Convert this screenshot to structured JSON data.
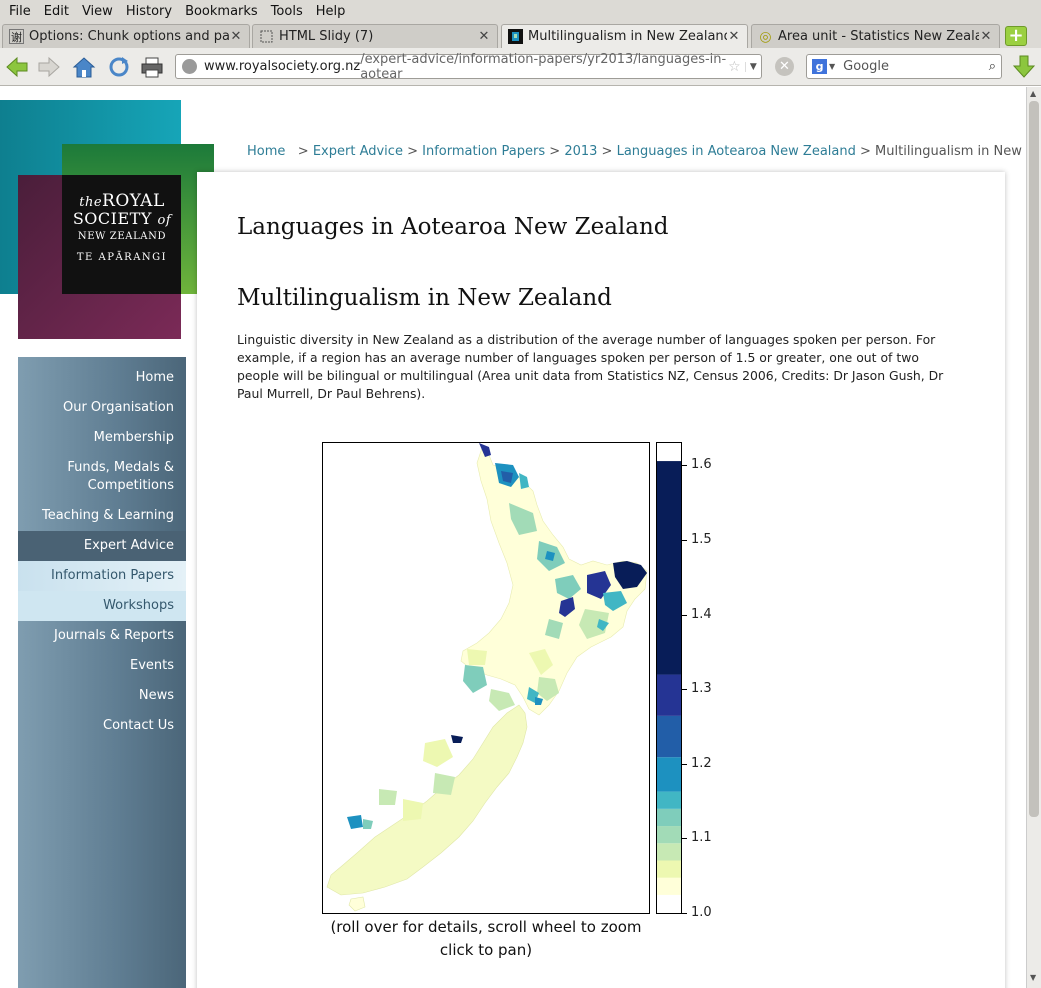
{
  "menubar": [
    "File",
    "Edit",
    "View",
    "History",
    "Bookmarks",
    "Tools",
    "Help"
  ],
  "tabs": [
    {
      "label": "Options: Chunk options and pa...",
      "icon": "谢"
    },
    {
      "label": "HTML Slidy (7)",
      "icon": ""
    },
    {
      "label": "Multilingualism in New Zealand ...",
      "icon": ""
    },
    {
      "label": "Area unit - Statistics New Zealand",
      "icon": "◎"
    }
  ],
  "url": {
    "host": "www.royalsociety.org.nz",
    "path": "/expert-advice/information-papers/yr2013/languages-in-aotear"
  },
  "search": {
    "placeholder": "Google"
  },
  "logo": {
    "line1_the": "the",
    "line1_royal": "ROYAL",
    "line2_society": "SOCIETY",
    "line2_of": "of",
    "line3": "NEW ZEALAND",
    "line4": "TE APĀRANGI"
  },
  "nav": [
    {
      "label": "Home",
      "state": "normal"
    },
    {
      "label": "Our Organisation",
      "state": "normal"
    },
    {
      "label": "Membership",
      "state": "normal"
    },
    {
      "label": "Funds, Medals & Competitions",
      "line1": "Funds, Medals &",
      "line2": "Competitions",
      "state": "normal"
    },
    {
      "label": "Teaching & Learning",
      "state": "normal"
    },
    {
      "label": "Expert Advice",
      "state": "active"
    },
    {
      "label": "Information Papers",
      "state": "sub"
    },
    {
      "label": "Workshops",
      "state": "sub"
    },
    {
      "label": "Journals & Reports",
      "state": "normal"
    },
    {
      "label": "Events",
      "state": "normal"
    },
    {
      "label": "News",
      "state": "normal"
    },
    {
      "label": "Contact Us",
      "state": "normal"
    }
  ],
  "breadcrumb": [
    {
      "label": "Home",
      "link": true
    },
    {
      "label": "Expert Advice",
      "link": true
    },
    {
      "label": "Information Papers",
      "link": true
    },
    {
      "label": "2013",
      "link": true
    },
    {
      "label": "Languages in Aotearoa New Zealand",
      "link": true
    },
    {
      "label": "Multilingualism in New Zealand",
      "link": false
    }
  ],
  "content": {
    "title": "Languages in Aotearoa New Zealand",
    "subtitle": "Multilingualism in New Zealand",
    "description": "Linguistic diversity in New Zealand as a distribution of the average number of languages spoken per person. For example, if a region has an average number of languages spoken per person of 1.5 or greater, one out of two people will be bilingual or multilingual (Area unit data from Statistics NZ, Census 2006, Credits: Dr Jason Gush, Dr Paul Murrell, Dr Paul Behrens).",
    "caption_line1": "(roll over for details, scroll wheel to zoom",
    "caption_line2": "click to pan)"
  },
  "legend": {
    "min": 1.0,
    "max": 1.63,
    "ticks": [
      1.0,
      1.1,
      1.2,
      1.3,
      1.4,
      1.5,
      1.6
    ],
    "tick_labels": [
      "1.0",
      "1.1",
      "1.2",
      "1.3",
      "1.4",
      "1.5",
      "1.6"
    ],
    "bins": [
      {
        "from": 1.0,
        "to": 1.025,
        "color": "#ffffd9"
      },
      {
        "from": 1.025,
        "to": 1.05,
        "color": "#edf8b1"
      },
      {
        "from": 1.05,
        "to": 1.075,
        "color": "#c7e9b4"
      },
      {
        "from": 1.075,
        "to": 1.1,
        "color": "#a2dbb7"
      },
      {
        "from": 1.1,
        "to": 1.125,
        "color": "#7fcdbb"
      },
      {
        "from": 1.125,
        "to": 1.15,
        "color": "#41b6c4"
      },
      {
        "from": 1.15,
        "to": 1.2,
        "color": "#1d91c0"
      },
      {
        "from": 1.2,
        "to": 1.26,
        "color": "#225ea8"
      },
      {
        "from": 1.26,
        "to": 1.32,
        "color": "#253494"
      },
      {
        "from": 1.32,
        "to": 1.63,
        "color": "#081d58"
      }
    ]
  },
  "colors": {
    "link": "#2e7d96",
    "nav_active": "#4a6274",
    "nav_sub": "#cfe6f1"
  }
}
